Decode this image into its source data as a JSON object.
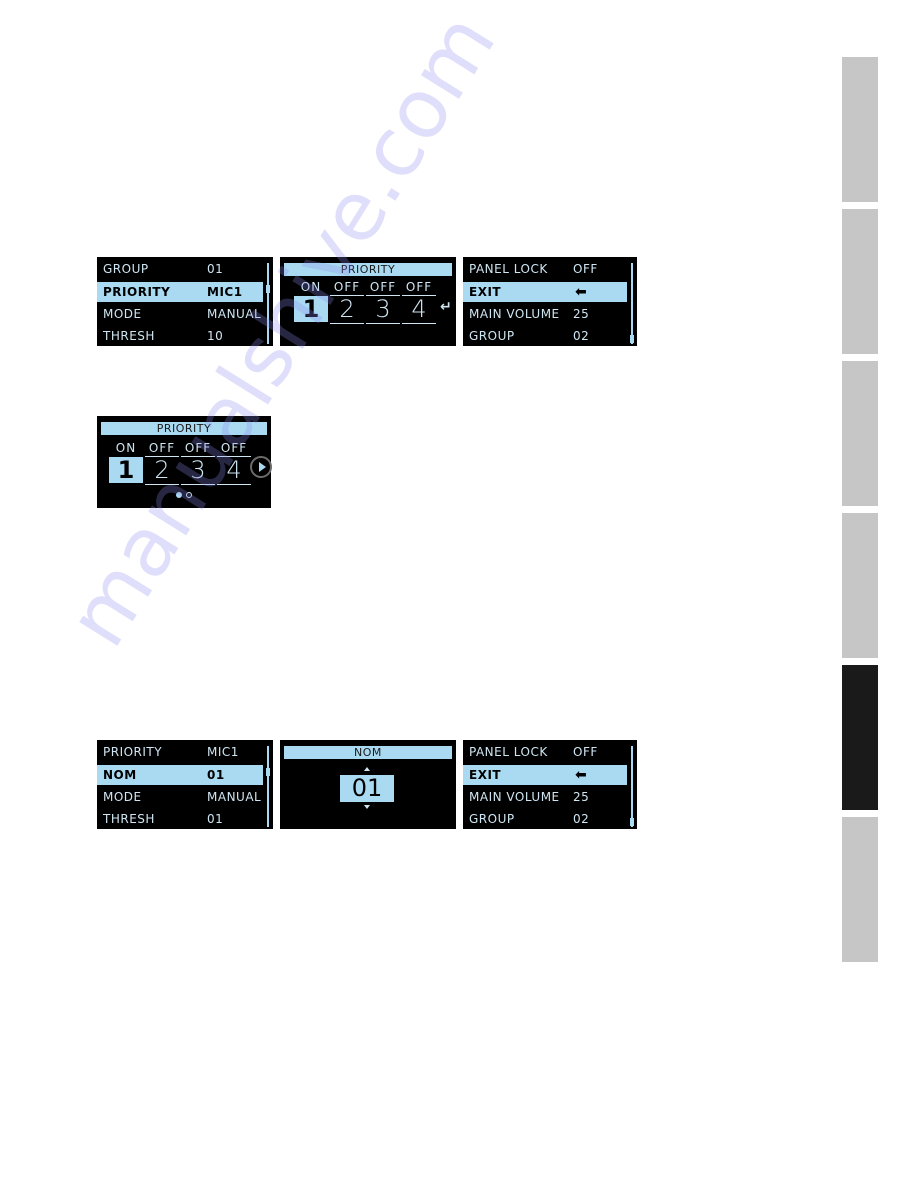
{
  "side_tabs": [
    {
      "active": false
    },
    {
      "active": false
    },
    {
      "active": false
    },
    {
      "active": false
    },
    {
      "active": true
    },
    {
      "active": false
    }
  ],
  "figure1": {
    "menu_screen": {
      "rows": [
        {
          "label": "GROUP",
          "value": "01",
          "selected": false
        },
        {
          "label": "PRIORITY",
          "value": "MIC1",
          "selected": true
        },
        {
          "label": "MODE",
          "value": "MANUAL",
          "selected": false
        },
        {
          "label": "THRESH",
          "value": "10",
          "selected": false
        }
      ]
    },
    "priority_screen": {
      "title": "PRIORITY",
      "channels": [
        {
          "number": "1",
          "state": "ON",
          "selected": true
        },
        {
          "number": "2",
          "state": "OFF",
          "selected": false
        },
        {
          "number": "3",
          "state": "OFF",
          "selected": false
        },
        {
          "number": "4",
          "state": "OFF",
          "selected": false
        }
      ],
      "enter_icon": "↵"
    },
    "exit_screen": {
      "rows": [
        {
          "label": "PANEL LOCK",
          "value": "OFF",
          "selected": false
        },
        {
          "label": "EXIT",
          "value": "⬅",
          "selected": true
        },
        {
          "label": "MAIN VOLUME",
          "value": "25",
          "selected": false
        },
        {
          "label": "GROUP",
          "value": "02",
          "selected": false
        }
      ]
    }
  },
  "figure2": {
    "priority_screen": {
      "title": "PRIORITY",
      "channels": [
        {
          "number": "1",
          "state": "ON",
          "selected": true
        },
        {
          "number": "2",
          "state": "OFF",
          "selected": false
        },
        {
          "number": "3",
          "state": "OFF",
          "selected": false
        },
        {
          "number": "4",
          "state": "OFF",
          "selected": false
        }
      ],
      "page_indicator": {
        "current": 1,
        "total": 2
      }
    }
  },
  "figure3": {
    "menu_screen": {
      "rows": [
        {
          "label": "PRIORITY",
          "value": "MIC1",
          "selected": false
        },
        {
          "label": "NOM",
          "value": "01",
          "selected": true
        },
        {
          "label": "MODE",
          "value": "MANUAL",
          "selected": false
        },
        {
          "label": "THRESH",
          "value": "01",
          "selected": false
        }
      ]
    },
    "nom_screen": {
      "title": "NOM",
      "value": "01"
    },
    "exit_screen": {
      "rows": [
        {
          "label": "PANEL LOCK",
          "value": "OFF",
          "selected": false
        },
        {
          "label": "EXIT",
          "value": "⬅",
          "selected": true
        },
        {
          "label": "MAIN VOLUME",
          "value": "25",
          "selected": false
        },
        {
          "label": "GROUP",
          "value": "02",
          "selected": false
        }
      ]
    }
  },
  "colors": {
    "lcd_background": "#000000",
    "lcd_text": "#cfe6f2",
    "lcd_highlight": "#a9daf2",
    "tab_inactive": "#c6c6c7",
    "tab_active": "#1b1a1a"
  },
  "watermark": {
    "text": "manualshive.com",
    "note": "third-party hosting-site overlay, not part of the original document"
  }
}
